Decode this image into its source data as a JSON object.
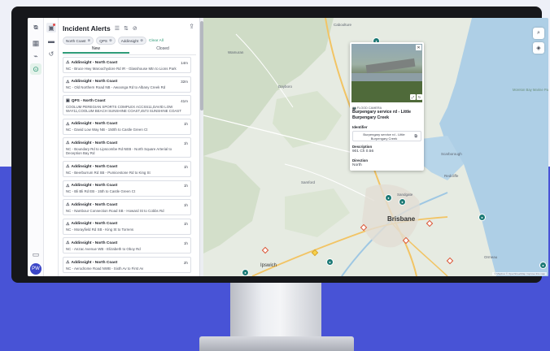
{
  "panel": {
    "title": "Incident Alerts",
    "filters": [
      {
        "label": "North Coast"
      },
      {
        "label": "QPS"
      },
      {
        "label": "Addinsight"
      }
    ],
    "clear_all": "Clear All",
    "tabs": [
      {
        "label": "New"
      },
      {
        "label": "Closed"
      }
    ]
  },
  "alerts": [
    {
      "source": "Addinsight - North Coast",
      "age": "14m",
      "desc": "NC - Bruce Hwy Maroochydore Rd IR - Glasshouse Mtn to Lions Park",
      "icon": "alert-icon"
    },
    {
      "source": "Addinsight - North Coast",
      "age": "32m",
      "desc": "NC - Old Northern Road NB - Awoonga Rd to Albany Creek Rd",
      "icon": "alert-icon"
    },
    {
      "source": "QPS - North Coast",
      "age": "41m",
      "desc": "COOLUM PEREGIAN SPORTS COMPLEX ACCSS11,DAVID LOW WAY11,COOLUM BEACH SUNSHINE COAST,4573 SUNSHINE COAST",
      "icon": "police-icon"
    },
    {
      "source": "Addinsight - North Coast",
      "age": "1h",
      "desc": "NC - David Low Way NB - 150th to Castle Green Ct",
      "icon": "alert-icon"
    },
    {
      "source": "Addinsight - North Coast",
      "age": "1h",
      "desc": "NC - Boundary Rd to Lipscombe Rd NEB - North Square Arterial to Deception Bay Rd",
      "icon": "alert-icon"
    },
    {
      "source": "Addinsight - North Coast",
      "age": "1h",
      "desc": "NC - Beerburrum Rd SB - Pumicestone Rd to King St",
      "icon": "alert-icon"
    },
    {
      "source": "Addinsight - North Coast",
      "age": "1h",
      "desc": "NC - Bli Bli Rd EB - 15th to Castle Green Ct",
      "icon": "alert-icon"
    },
    {
      "source": "Addinsight - North Coast",
      "age": "1h",
      "desc": "NC - Nambour Connection Road SB - Howard St to Cobbs Rd",
      "icon": "alert-icon"
    },
    {
      "source": "Addinsight - North Coast",
      "age": "1h",
      "desc": "NC - Morayfield Rd SB - King St to Torrens",
      "icon": "alert-icon"
    },
    {
      "source": "Addinsight - North Coast",
      "age": "1h",
      "desc": "NC - Anzac Avenue WB - Elizabeth to Oboy Rd",
      "icon": "alert-icon"
    },
    {
      "source": "Addinsight - North Coast",
      "age": "2h",
      "desc": "NC - Aerodrome Road NWB - Sixth Av to First Av",
      "icon": "alert-icon"
    }
  ],
  "popup": {
    "category": "FLOOD CAMERA",
    "title": "Burpengary service rd - Little Burpengary Creek",
    "identifier_label": "Identifier",
    "identifier_value": "Burpengary service rd - Little Burpengary Creek",
    "description_label": "Description",
    "description_value": "901 Ch 0.56",
    "direction_label": "Direction",
    "direction_value": "North"
  },
  "map": {
    "labels": {
      "brisbane": "Brisbane",
      "ipswich": "Ipswich",
      "moreton_bay": "Moreton Bay Marine Park",
      "redcliffe": "Redcliffe",
      "scarborough": "Scarborough",
      "sandgate": "Sandgate",
      "ormeau": "Ormeau",
      "samford": "Samford",
      "dayboro": "Dayboro",
      "caboolture": "Caboolture",
      "wamuran": "Wamuran"
    },
    "attribution": "© Mapbox © OpenStreetMap Improve this map"
  },
  "colors": {
    "accent": "#2e9b78",
    "marker": "#1d7a76",
    "backdrop_top": "#eef0f8",
    "backdrop_bottom": "#4853d6"
  }
}
